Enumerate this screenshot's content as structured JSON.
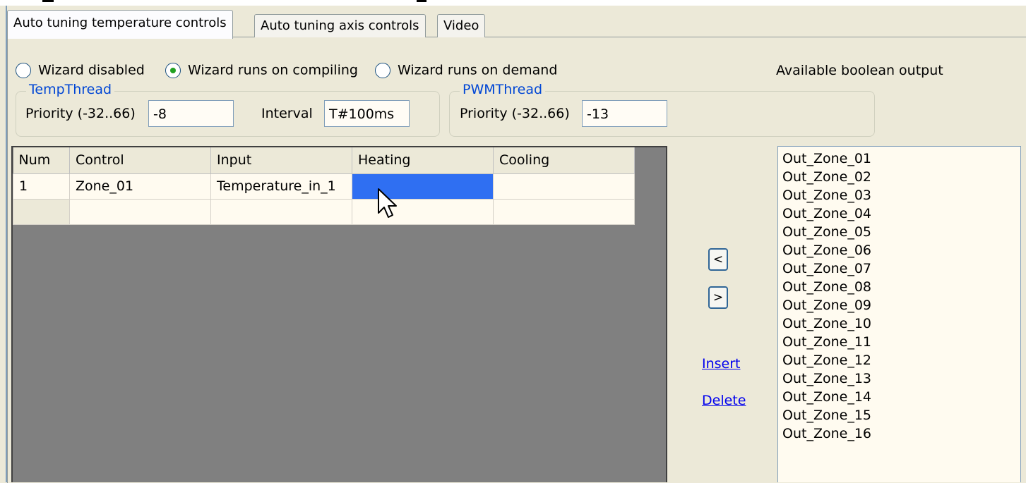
{
  "tabs": [
    {
      "label": "Auto tuning temperature controls",
      "active": true
    },
    {
      "label": "Auto tuning axis controls",
      "active": false
    },
    {
      "label": "Video",
      "active": false
    }
  ],
  "wizard": {
    "options": [
      {
        "label": "Wizard disabled",
        "selected": false
      },
      {
        "label": "Wizard runs on compiling",
        "selected": true
      },
      {
        "label": "Wizard runs on demand",
        "selected": false
      }
    ]
  },
  "temp_thread": {
    "legend": "TempThread",
    "priority_label": "Priority (-32..66)",
    "priority_value": "-8",
    "interval_label": "Interval",
    "interval_value": "T#100ms"
  },
  "pwm_thread": {
    "legend": "PWMThread",
    "priority_label": "Priority (-32..66)",
    "priority_value": "-13"
  },
  "grid": {
    "columns": [
      "Num",
      "Control",
      "Input",
      "Heating",
      "Cooling"
    ],
    "rows": [
      {
        "num": "1",
        "control": "Zone_01",
        "input": "Temperature_in_1",
        "heating": "",
        "cooling": ""
      }
    ]
  },
  "buttons": {
    "move_left": "<",
    "move_right": ">",
    "insert": "Insert",
    "delete": "Delete"
  },
  "available": {
    "label": "Available boolean output",
    "items": [
      "Out_Zone_01",
      "Out_Zone_02",
      "Out_Zone_03",
      "Out_Zone_04",
      "Out_Zone_05",
      "Out_Zone_06",
      "Out_Zone_07",
      "Out_Zone_08",
      "Out_Zone_09",
      "Out_Zone_10",
      "Out_Zone_11",
      "Out_Zone_12",
      "Out_Zone_13",
      "Out_Zone_14",
      "Out_Zone_15",
      "Out_Zone_16"
    ]
  },
  "colors": {
    "selection": "#2f6ff2",
    "groupbox_legend": "#0046d5",
    "radio_dot": "#21a121",
    "link": "#0000ee"
  }
}
